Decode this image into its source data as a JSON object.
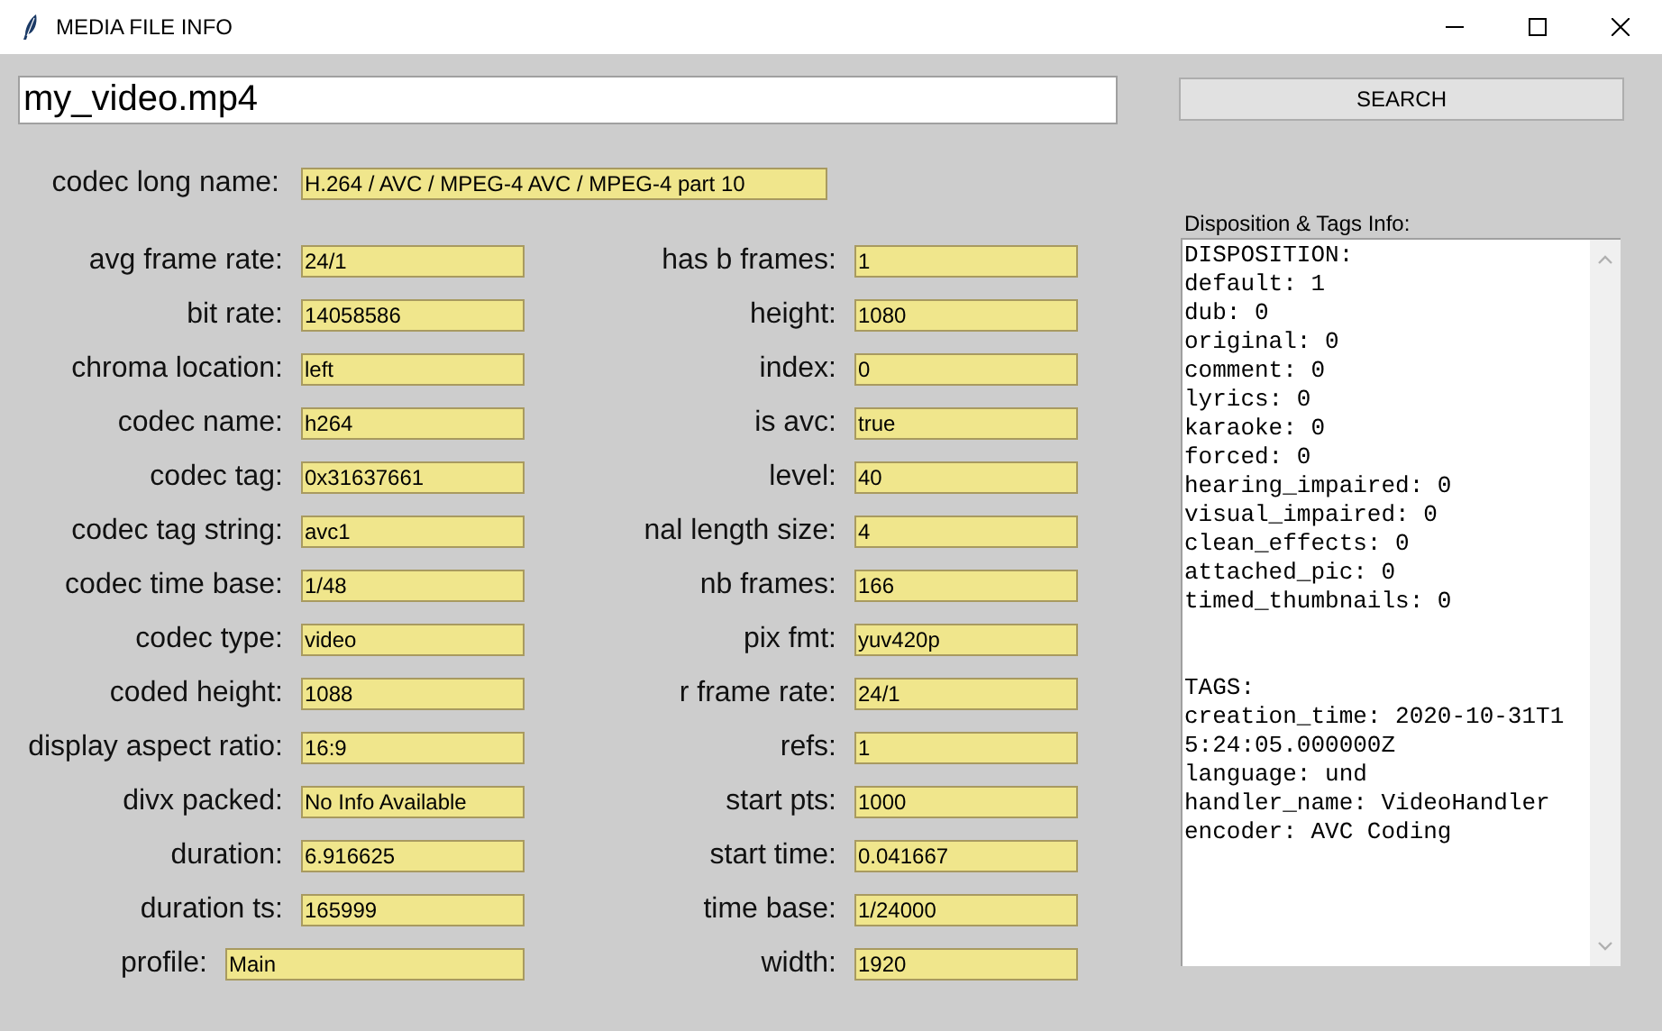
{
  "window": {
    "title": "MEDIA FILE INFO"
  },
  "search": {
    "value": "my_video.mp4",
    "button": "SEARCH"
  },
  "long_name": {
    "label": "codec long name:",
    "value": "H.264 / AVC / MPEG-4 AVC / MPEG-4 part 10"
  },
  "columns": [
    [
      {
        "label": "avg frame rate:",
        "value": "24/1",
        "kind": "entry"
      },
      {
        "label": "bit rate:",
        "value": "14058586",
        "kind": "entry"
      },
      {
        "label": "chroma location:",
        "value": "left",
        "kind": "entry"
      },
      {
        "label": "codec name:",
        "value": "h264",
        "kind": "entry"
      },
      {
        "label": "codec tag:",
        "value": "0x31637661",
        "kind": "entry"
      },
      {
        "label": "codec tag string:",
        "value": "avc1",
        "kind": "entry"
      },
      {
        "label": "codec time base:",
        "value": "1/48",
        "kind": "entry"
      },
      {
        "label": "codec type:",
        "value": "video",
        "kind": "entry"
      },
      {
        "label": "coded height:",
        "value": "1088",
        "kind": "entry"
      },
      {
        "label": "display aspect ratio:",
        "value": "16:9",
        "kind": "entry"
      },
      {
        "label": "divx packed:",
        "value": "No Info Available",
        "kind": "entry"
      },
      {
        "label": "duration:",
        "value": "6.916625",
        "kind": "entry"
      },
      {
        "label": "duration ts:",
        "value": "165999",
        "kind": "entry"
      },
      {
        "label": "profile:",
        "value": "Main",
        "kind": "wide"
      }
    ],
    [
      {
        "label": "has b frames:",
        "value": "1",
        "kind": "entry"
      },
      {
        "label": "height:",
        "value": "1080",
        "kind": "entry"
      },
      {
        "label": "index:",
        "value": "0",
        "kind": "entry"
      },
      {
        "label": "is avc:",
        "value": "true",
        "kind": "entry"
      },
      {
        "label": "level:",
        "value": "40",
        "kind": "entry"
      },
      {
        "label": "nal length size:",
        "value": "4",
        "kind": "entry"
      },
      {
        "label": "nb frames:",
        "value": "166",
        "kind": "entry"
      },
      {
        "label": "pix fmt:",
        "value": "yuv420p",
        "kind": "entry"
      },
      {
        "label": "r frame rate:",
        "value": "24/1",
        "kind": "entry"
      },
      {
        "label": "refs:",
        "value": "1",
        "kind": "entry"
      },
      {
        "label": "start pts:",
        "value": "1000",
        "kind": "entry"
      },
      {
        "label": "start time:",
        "value": "0.041667",
        "kind": "entry"
      },
      {
        "label": "time base:",
        "value": "1/24000",
        "kind": "entry"
      },
      {
        "label": "width:",
        "value": "1920",
        "kind": "entry"
      }
    ]
  ],
  "info_panel": {
    "label": "Disposition & Tags Info:",
    "sections": [
      {
        "heading": "DISPOSITION:",
        "lines": [
          "default: 1",
          "dub: 0",
          "original: 0",
          "comment: 0",
          "lyrics: 0",
          "karaoke: 0",
          "forced: 0",
          "hearing_impaired: 0",
          "visual_impaired: 0",
          "clean_effects: 0",
          "attached_pic: 0",
          "timed_thumbnails: 0"
        ]
      },
      {
        "heading": "TAGS:",
        "lines": [
          "creation_time: 2020-10-31T15:24:05.000000Z",
          "language: und",
          "handler_name: VideoHandler",
          "encoder: AVC Coding"
        ]
      }
    ]
  }
}
